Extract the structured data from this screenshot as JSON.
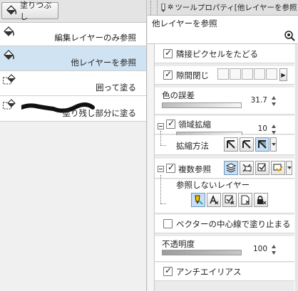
{
  "left_panel": {
    "group_tab_label": "塗りつぶし",
    "items": [
      {
        "label": "編集レイヤーのみ参照"
      },
      {
        "label": "他レイヤーを参照"
      },
      {
        "label": "囲って塗る"
      },
      {
        "label": "塗り残し部分に塗る"
      }
    ]
  },
  "right_panel": {
    "tab_title": "ツールプロパティ[他レイヤーを参照",
    "subtool_name": "他レイヤーを参照",
    "props": {
      "adjacent_pixel": "隣接ピクセルをたどる",
      "close_gap": "隙間閉じ",
      "color_margin": "色の誤差",
      "color_margin_value": "31.7",
      "area_scaling": "領域拡縮",
      "area_scaling_value": "10",
      "scaling_method": "拡縮方法",
      "multiple_ref": "複数参照",
      "exclude_layers": "参照しないレイヤー",
      "vector_center": "ベクターの中心線で塗り止まる",
      "opacity": "不透明度",
      "opacity_value": "100",
      "antialiasing": "アンチエイリアス"
    }
  }
}
